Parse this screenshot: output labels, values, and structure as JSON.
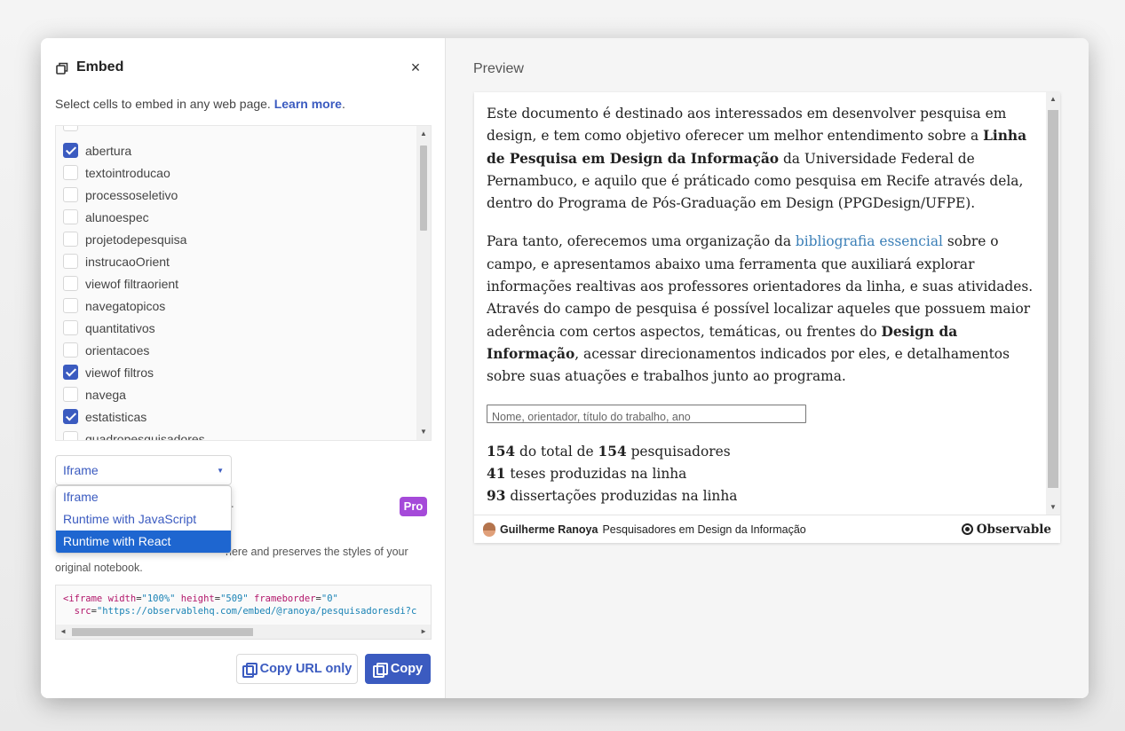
{
  "dialog": {
    "title": "Embed",
    "close_symbol": "×",
    "icon": "embed-icon",
    "intro_text": "Select cells to embed in any web page.",
    "learn_more": "Learn more",
    "period": "."
  },
  "cells": [
    {
      "label": "abertura",
      "checked": true
    },
    {
      "label": "textointroducao",
      "checked": false
    },
    {
      "label": "processoseletivo",
      "checked": false
    },
    {
      "label": "alunoespec",
      "checked": false
    },
    {
      "label": "projetodepesquisa",
      "checked": false
    },
    {
      "label": "instrucaoOrient",
      "checked": false
    },
    {
      "label": "viewof filtraorient",
      "checked": false
    },
    {
      "label": "navegatopicos",
      "checked": false
    },
    {
      "label": "quantitativos",
      "checked": false
    },
    {
      "label": "orientacoes",
      "checked": false
    },
    {
      "label": "viewof filtros",
      "checked": true
    },
    {
      "label": "navega",
      "checked": false
    },
    {
      "label": "estatisticas",
      "checked": true
    },
    {
      "label": "quadropesquisadores",
      "checked": false
    }
  ],
  "embed_type": {
    "selected": "Iframe",
    "options": [
      "Iframe",
      "Runtime with JavaScript",
      "Runtime with React"
    ],
    "highlighted": "Runtime with React"
  },
  "partial_label": "r",
  "pro_badge": "Pro",
  "description": {
    "line1_end": "nere and preserves the styles of your",
    "line2": "original notebook."
  },
  "code": {
    "line1": {
      "tag": "<iframe",
      "width_attr": "width",
      "width_val": "\"100%\"",
      "height_attr": "height",
      "height_val": "\"509\"",
      "fb_attr": "frameborder",
      "fb_val": "\"0\""
    },
    "line2": {
      "src_attr": "src",
      "src_val": "\"https://observablehq.com/embed/@ranoya/pesquisadoresdi?c"
    }
  },
  "buttons": {
    "copy_url": "Copy URL only",
    "copy": "Copy"
  },
  "preview": {
    "label": "Preview",
    "p1": {
      "a": "Este documento é destinado aos interessados em desenvolver pesquisa em design, e tem como objetivo oferecer um melhor entendimento sobre a ",
      "b": "Linha de Pesquisa em Design da Informação",
      "c": " da Universidade Federal de Pernambuco, e aquilo que é práticado como pesquisa em Recife através dela, dentro do Programa de Pós-Graduação em Design (PPGDesign/UFPE)."
    },
    "p2": {
      "a": "Para tanto, oferecemos uma organização da ",
      "link": "bibliografia essencial",
      "b": " sobre o campo, e apresentamos abaixo uma ferramenta que auxiliará explorar informações realtivas aos professores orientadores da linha, e suas atividades. Através do campo de pesquisa é possível localizar aqueles que possuem maior aderência com certos aspectos, temáticas, ou frentes do ",
      "bold": "Design da Informação",
      "c": ", acessar direcionamentos indicados por eles, e detalhamentos sobre suas atuações e trabalhos junto ao programa."
    },
    "search_placeholder": "Nome, orientador, título do trabalho, ano",
    "stats": [
      {
        "n1": "154",
        "t1": " do total de ",
        "n2": "154",
        "t2": " pesquisadores"
      },
      {
        "n1": "41",
        "t1": " teses produzidas na linha"
      },
      {
        "n1": "93",
        "t1": " dissertações produzidas na linha"
      }
    ],
    "footer": {
      "author": "Guilherme Ranoya",
      "notebook": "Pesquisadores em Design da Informação",
      "brand": "Observable"
    }
  },
  "colors": {
    "accent": "#3b5bc0",
    "pro": "#a54ad9",
    "highlight": "#1e66d0",
    "link": "#3b7fb7"
  }
}
